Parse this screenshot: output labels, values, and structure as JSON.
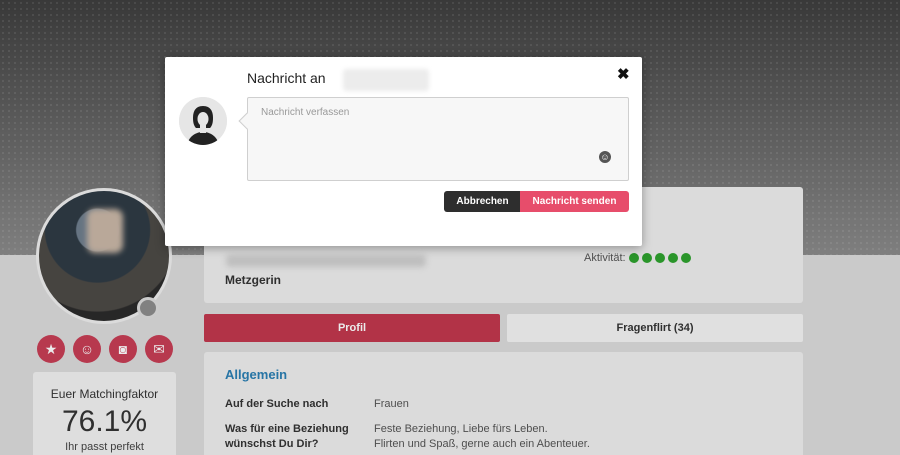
{
  "modal": {
    "title": "Nachricht an",
    "close_icon": "close-icon",
    "message_placeholder": "Nachricht verfassen",
    "message_value": "",
    "emoji_icon": "smiley-icon",
    "cancel_label": "Abbrechen",
    "send_label": "Nachricht senden"
  },
  "profile": {
    "job": "Metzgerin",
    "activity_label": "Aktivität:",
    "activity_level": 5,
    "activity_color": "#2ea22e",
    "actions": [
      "star-icon",
      "smiley-icon",
      "camera-icon",
      "mail-icon"
    ]
  },
  "match": {
    "label": "Euer Matchingfaktor",
    "value": "76.1%",
    "caption": "Ihr passt perfekt"
  },
  "tabs": {
    "profil": "Profil",
    "fragenflirt": "Fragenflirt (34)"
  },
  "general": {
    "heading": "Allgemein",
    "row1_label": "Auf der Suche nach",
    "row1_value": "Frauen",
    "row2_label_line1": "Was für eine Beziehung",
    "row2_label_line2": "wünschst Du Dir?",
    "row2_value_line1": "Feste Beziehung, Liebe fürs Leben.",
    "row2_value_line2": "Flirten und Spaß, gerne auch ein Abenteuer."
  },
  "colors": {
    "accent": "#c2384e",
    "send_button": "#e74d6b",
    "heading_blue": "#2b7fb3"
  }
}
